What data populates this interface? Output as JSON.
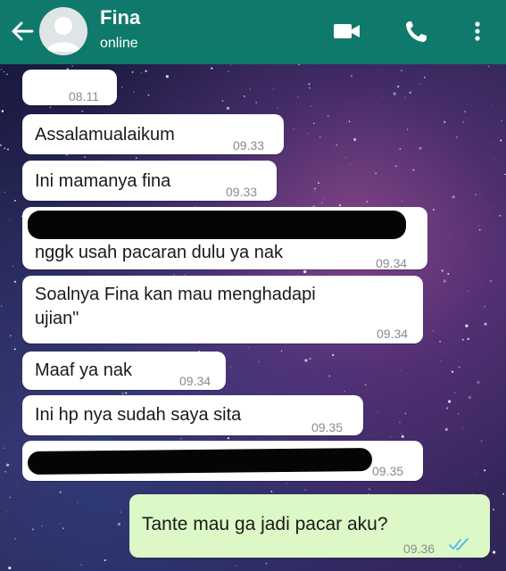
{
  "header": {
    "contact_name": "Fina",
    "status": "online",
    "icons": [
      "back-arrow-icon",
      "video-call-icon",
      "phone-icon",
      "more-vertical-icon"
    ],
    "color": "#0f7a6b"
  },
  "messages": [
    {
      "text": "",
      "time": "08.11",
      "direction": "in"
    },
    {
      "text": "Assalamualaikum",
      "time": "09.33",
      "direction": "in"
    },
    {
      "text": "Ini mamanya fina",
      "time": "09.33",
      "direction": "in"
    },
    {
      "text": "nggk usah pacaran dulu ya nak",
      "time": "09.34",
      "direction": "in",
      "redacted_line": true
    },
    {
      "text_line1": "Soalnya Fina kan mau menghadapi",
      "text_line2": "ujian\"",
      "time": "09.34",
      "direction": "in"
    },
    {
      "text": "Maaf ya nak",
      "time": "09.34",
      "direction": "in"
    },
    {
      "text": "Ini hp nya sudah saya sita",
      "time": "09.35",
      "direction": "in"
    },
    {
      "text": "",
      "time": "09.35",
      "direction": "in",
      "redacted": true
    },
    {
      "text": "Tante mau ga jadi pacar aku?",
      "time": "09.36",
      "direction": "out",
      "read": true
    }
  ],
  "colors": {
    "outgoing_bubble": "#dcf8c6",
    "incoming_bubble": "#ffffff",
    "read_tick": "#4fb6ec"
  }
}
